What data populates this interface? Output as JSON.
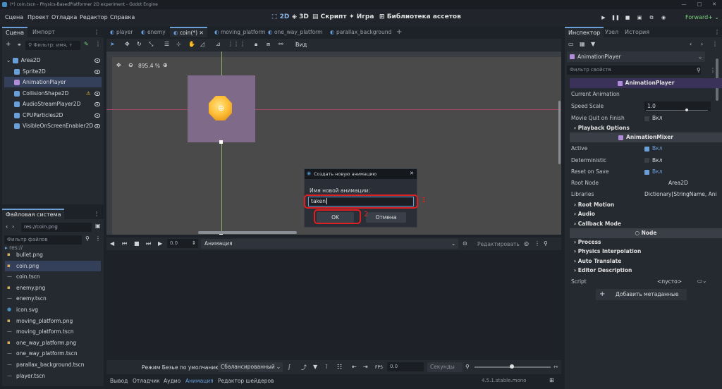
{
  "window": {
    "title": "(*) coin.tscn - Physics-BasedPlatformer 2D experiment - Godot Engine"
  },
  "menu": [
    "Сцена",
    "Проект",
    "Отладка",
    "Редактор",
    "Справка"
  ],
  "workspaces": [
    {
      "label": "2D",
      "active": true
    },
    {
      "label": "3D",
      "active": false
    },
    {
      "label": "Скрипт",
      "active": false
    },
    {
      "label": "Игра",
      "active": false
    },
    {
      "label": "Библиотека ассетов",
      "active": false
    }
  ],
  "renderer": "Forward+",
  "scene_panel": {
    "tabs": [
      "Сцена",
      "Импорт"
    ],
    "filter_placeholder": "Фильтр: имя, т",
    "nodes": [
      {
        "label": "Area2D",
        "icon": "area2d-icon",
        "color": "#6a9fd8",
        "depth": 0,
        "warning": false,
        "selected": false
      },
      {
        "label": "Sprite2D",
        "icon": "sprite2d-icon",
        "color": "#6a9fd8",
        "depth": 1,
        "warning": false,
        "selected": false
      },
      {
        "label": "AnimationPlayer",
        "icon": "animationplayer-icon",
        "color": "#b18cd8",
        "depth": 1,
        "warning": false,
        "selected": true
      },
      {
        "label": "CollisionShape2D",
        "icon": "collisionshape2d-icon",
        "color": "#6a9fd8",
        "depth": 1,
        "warning": true,
        "selected": false
      },
      {
        "label": "AudioStreamPlayer2D",
        "icon": "audiostreamplayer2d-icon",
        "color": "#6a9fd8",
        "depth": 1,
        "warning": false,
        "selected": false
      },
      {
        "label": "CPUParticles2D",
        "icon": "cpuparticles2d-icon",
        "color": "#6a9fd8",
        "depth": 1,
        "warning": false,
        "selected": false
      },
      {
        "label": "VisibleOnScreenEnabler2D",
        "icon": "visibleonscreenenabler2d-icon",
        "color": "#6a9fd8",
        "depth": 1,
        "warning": false,
        "selected": false
      }
    ]
  },
  "filesystem": {
    "tab": "Файловая система",
    "path": "res://coin.png",
    "filter_placeholder": "Фильтр файлов",
    "partial_top": "res://",
    "files": [
      {
        "label": "bullet.png",
        "icon": "image-icon",
        "selected": false
      },
      {
        "label": "coin.png",
        "icon": "image-icon",
        "selected": true
      },
      {
        "label": "coin.tscn",
        "icon": "scene-icon",
        "selected": false
      },
      {
        "label": "enemy.png",
        "icon": "image-icon",
        "selected": false
      },
      {
        "label": "enemy.tscn",
        "icon": "scene-icon",
        "selected": false
      },
      {
        "label": "icon.svg",
        "icon": "svg-icon",
        "selected": false
      },
      {
        "label": "moving_platform.png",
        "icon": "image-icon",
        "selected": false
      },
      {
        "label": "moving_platform.tscn",
        "icon": "scene-icon",
        "selected": false
      },
      {
        "label": "one_way_platform.png",
        "icon": "image-icon",
        "selected": false
      },
      {
        "label": "one_way_platform.tscn",
        "icon": "scene-icon",
        "selected": false
      },
      {
        "label": "parallax_background.tscn",
        "icon": "scene-icon",
        "selected": false
      },
      {
        "label": "player.tscn",
        "icon": "scene-icon",
        "selected": false
      }
    ]
  },
  "editor_tabs": [
    {
      "label": "player",
      "active": false
    },
    {
      "label": "enemy",
      "active": false
    },
    {
      "label": "coin(*)",
      "active": true
    },
    {
      "label": "moving_platform",
      "active": false
    },
    {
      "label": "one_way_platform",
      "active": false
    },
    {
      "label": "parallax_background",
      "active": false
    }
  ],
  "viewport": {
    "zoom": "895.4 %",
    "view_menu": "Вид"
  },
  "dialog": {
    "title": "Создать новую анимацию",
    "field_label": "Имя новой анимации:",
    "field_value": "taken",
    "ok": "OK",
    "cancel": "Отмена",
    "annotation_1": "1",
    "annotation_2": "2"
  },
  "animation_panel": {
    "time": "0.0",
    "anim_menu": "Анимация",
    "edit": "Редактировать",
    "bezier_label": "Режим Безье по умолчанию:",
    "bezier_value": "Сбалансированный",
    "fps": "FPS",
    "snap_value": "0.0",
    "unit": "Секунды"
  },
  "bottom_tabs": [
    "Вывод",
    "Отладчик",
    "Аудио",
    "Анимация",
    "Редактор шейдеров"
  ],
  "bottom_active": "Анимация",
  "version": "4.5.1.stable.mono",
  "inspector": {
    "tabs": [
      "Инспектор",
      "Узел",
      "История"
    ],
    "node": "AnimationPlayer",
    "filter_placeholder": "Фильтр свойств",
    "class_header": "AnimationPlayer",
    "props": [
      {
        "label": "Current Animation",
        "value": ""
      },
      {
        "label": "Speed Scale",
        "value": "1.0"
      },
      {
        "label": "Movie Quit on Finish",
        "value": "Вкл"
      }
    ],
    "playback_options": "Playback Options",
    "mixer_header": "AnimationMixer",
    "mixer_props": [
      {
        "label": "Active",
        "value": "Вкл",
        "checked": true
      },
      {
        "label": "Deterministic",
        "value": "Вкл",
        "checked": false
      },
      {
        "label": "Reset on Save",
        "value": "Вкл",
        "checked": true
      }
    ],
    "root_node_label": "Root Node",
    "root_node_value": "Area2D",
    "libraries_label": "Libraries",
    "libraries_value": "Dictionary[StringName, Ani",
    "mixer_sections": [
      "Root Motion",
      "Audio",
      "Callback Mode"
    ],
    "node_header": "Node",
    "node_sections": [
      "Process",
      "Physics Interpolation",
      "Auto Translate",
      "Editor Description"
    ],
    "script_label": "Script",
    "script_value": "<пусто>",
    "add_meta": "Добавить метаданные"
  }
}
